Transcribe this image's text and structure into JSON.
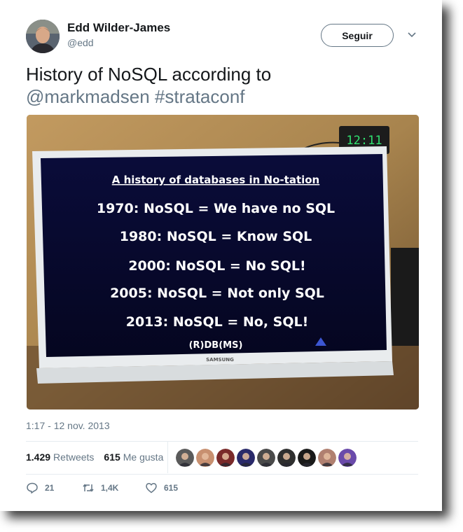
{
  "author": {
    "name": "Edd Wilder-James",
    "handle": "@edd"
  },
  "follow_label": "Seguir",
  "tweet": {
    "text_line1": "History of NoSQL according to",
    "mention": "@markmadsen",
    "hashtag": "#strataconf"
  },
  "media": {
    "clock": "12:11",
    "slide_title": "A history of databases in No-tation",
    "slide_lines": [
      "1970: NoSQL = We have no SQL",
      "1980: NoSQL = Know SQL",
      "2000: NoSQL = No SQL!",
      "2005: NoSQL = Not only SQL",
      "2013: NoSQL = No, SQL!"
    ],
    "slide_footer": "(R)DB(MS)",
    "brand": "SAMSUNG"
  },
  "timestamp": "1:17 - 12 nov. 2013",
  "stats": {
    "retweets_count": "1.429",
    "retweets_label": "Retweets",
    "likes_count": "615",
    "likes_label": "Me gusta"
  },
  "liker_avatars": [
    "#5a5a5a",
    "#c89070",
    "#7a2a2a",
    "#2a2a6a",
    "#4a4a4a",
    "#2f2f2f",
    "#1a1a1a",
    "#b08070",
    "#6a4aaa"
  ],
  "actions": {
    "replies": "21",
    "retweets": "1,4K",
    "likes": "615"
  }
}
